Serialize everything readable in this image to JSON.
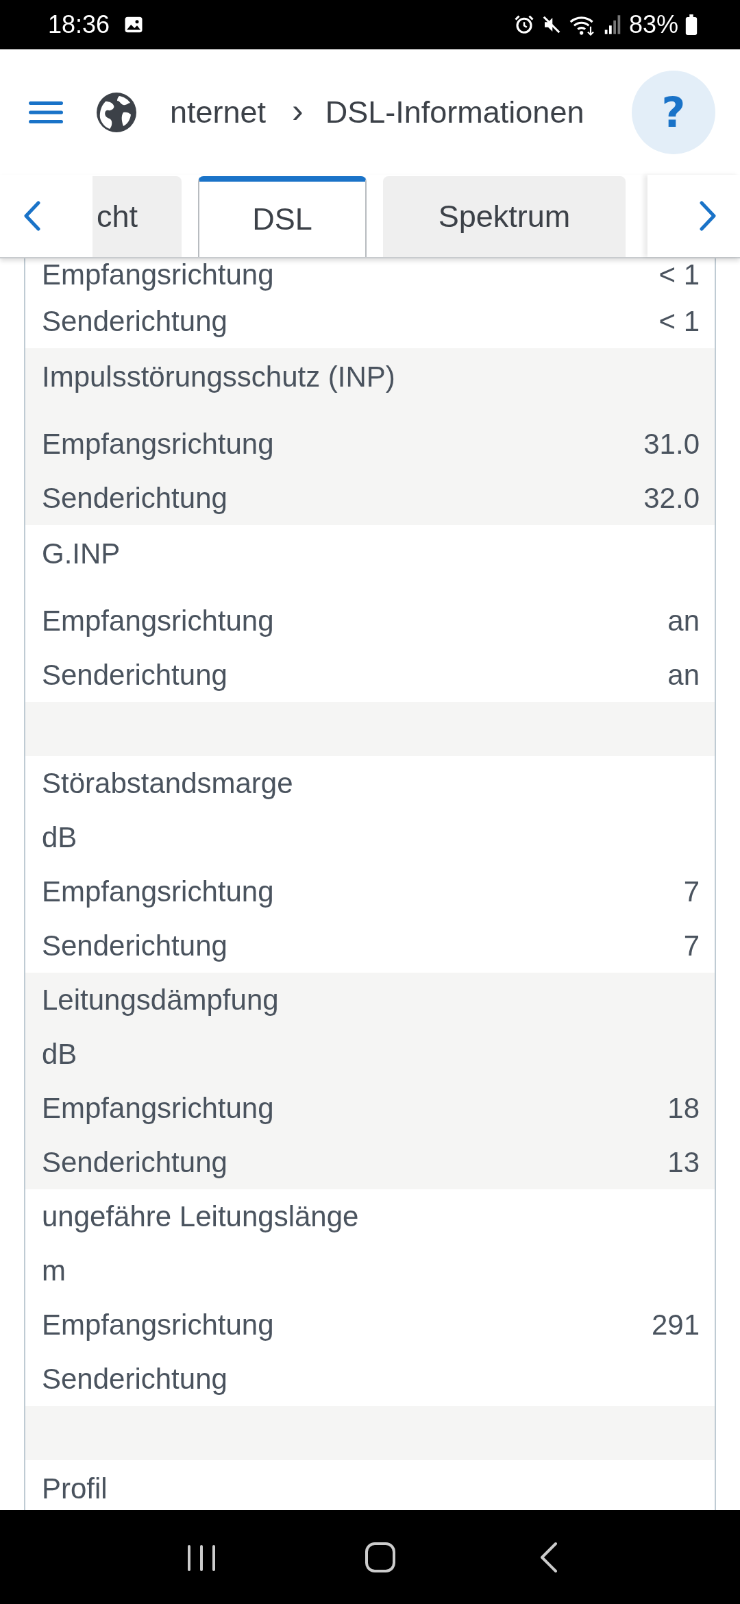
{
  "status_bar": {
    "time": "18:36",
    "battery": "83%"
  },
  "header": {
    "breadcrumb": "nternet",
    "separator": "›",
    "title": "DSL-Informationen",
    "help": "?"
  },
  "tabs": [
    {
      "label": "cht",
      "selected": false
    },
    {
      "label": "DSL",
      "selected": true
    },
    {
      "label": "Spektrum",
      "selected": false
    }
  ],
  "groups": [
    {
      "rows": [
        {
          "label": "Empfangsrichtung",
          "value": "< 1"
        },
        {
          "label": "Senderichtung",
          "value": "< 1"
        }
      ]
    },
    {
      "title": "Impulsstörungsschutz (INP)",
      "rows": [
        {
          "label": "Empfangsrichtung",
          "value": "31.0"
        },
        {
          "label": "Senderichtung",
          "value": "32.0"
        }
      ]
    },
    {
      "title": "G.INP",
      "rows": [
        {
          "label": "Empfangsrichtung",
          "value": "an"
        },
        {
          "label": "Senderichtung",
          "value": "an"
        }
      ]
    },
    {
      "kind": "spacer"
    },
    {
      "title": "Störabstandsmarge",
      "unit": "dB",
      "rows": [
        {
          "label": "Empfangsrichtung",
          "value": "7"
        },
        {
          "label": "Senderichtung",
          "value": "7"
        }
      ]
    },
    {
      "title": "Leitungsdämpfung",
      "unit": "dB",
      "rows": [
        {
          "label": "Empfangsrichtung",
          "value": "18"
        },
        {
          "label": "Senderichtung",
          "value": "13"
        }
      ]
    },
    {
      "title": "ungefähre Leitungslänge",
      "unit": "m",
      "rows": [
        {
          "label": "Empfangsrichtung",
          "value": "291"
        },
        {
          "label": "Senderichtung"
        }
      ]
    },
    {
      "kind": "spacer"
    },
    {
      "title": "Profil"
    }
  ]
}
